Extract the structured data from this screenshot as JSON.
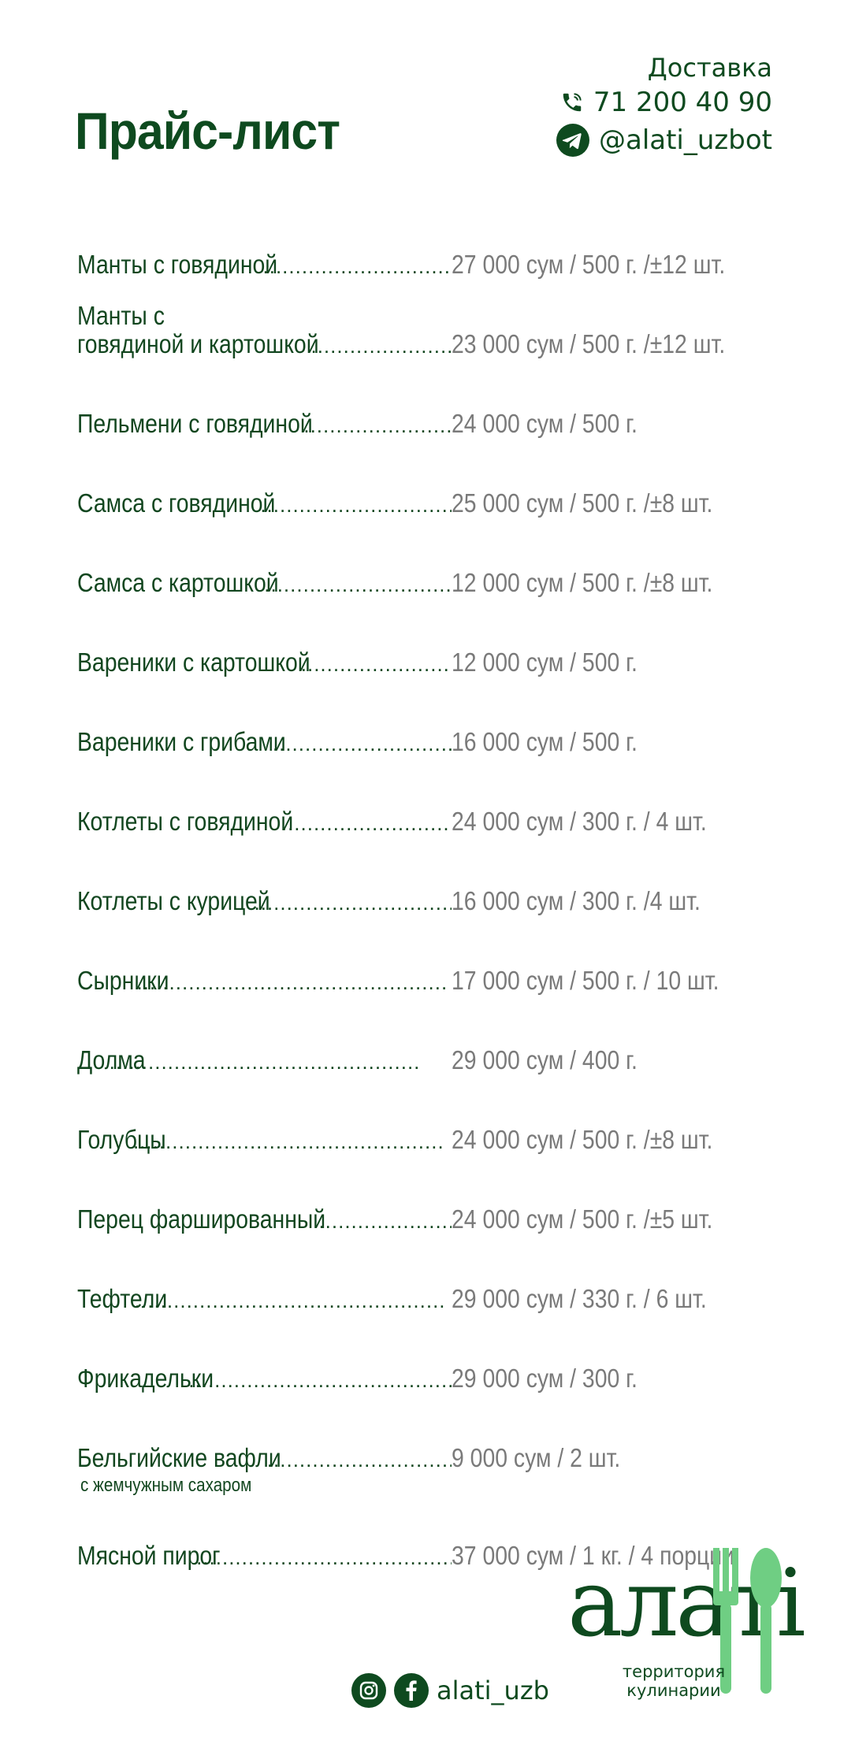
{
  "header": {
    "title": "Прайс-лист",
    "delivery_label": "Доставка",
    "phone": "71 200 40 90",
    "telegram": "@alati_uzbot"
  },
  "items": [
    {
      "name": "Манты с говядиной",
      "price": "27 000 сум / 500 г. /±12 шт."
    },
    {
      "name_line1": "Манты с",
      "name": "говядиной и картошкой",
      "price": "23 000 сум / 500 г. /±12 шт."
    },
    {
      "name": "Пельмени с говядиной",
      "price": "24 000 сум / 500 г."
    },
    {
      "name": "Самса с говядиной",
      "price": "25 000 сум / 500 г. /±8 шт."
    },
    {
      "name": "Самса с картошкой",
      "price": "12 000 сум / 500 г. /±8 шт."
    },
    {
      "name": "Вареники с картошкой",
      "price": "12 000 сум / 500 г."
    },
    {
      "name": "Вареники с грибами",
      "price": "16 000 сум / 500 г."
    },
    {
      "name": "Котлеты с говядиной",
      "price": "24 000 сум / 300 г. / 4 шт."
    },
    {
      "name": "Котлеты с курицей",
      "price": "16 000 сум / 300 г. /4 шт."
    },
    {
      "name": "Сырники",
      "price": "17 000 сум / 500 г. / 10 шт."
    },
    {
      "name": "Долма",
      "price": "29 000 сум / 400 г."
    },
    {
      "name": "Голубцы",
      "price": "24 000 сум / 500 г. /±8 шт."
    },
    {
      "name": "Перец фаршированный",
      "price": "24 000 сум / 500 г. /±5 шт."
    },
    {
      "name": "Тефтели",
      "price": "29 000 сум / 330 г. / 6 шт."
    },
    {
      "name": "Фрикадельки",
      "price": "29 000 сум / 300 г."
    },
    {
      "name": "Бельгийские вафли",
      "subtitle": "с жемчужным сахаром",
      "price": "9 000 сум / 2 шт."
    },
    {
      "name": "Мясной пирог",
      "price": "37 000 сум / 1 кг. / 4 порции"
    }
  ],
  "logo": {
    "brand": "алатi",
    "tagline_line1": "территория",
    "tagline_line2": "кулинарии"
  },
  "social": {
    "handle": "alati_uzb",
    "instagram_icon": "instagram-icon",
    "facebook_icon": "facebook-icon"
  },
  "colors": {
    "brand_dark_green": "#0e4a1f",
    "accent_light_green": "#6fce83",
    "price_gray": "#7a7a7a"
  }
}
